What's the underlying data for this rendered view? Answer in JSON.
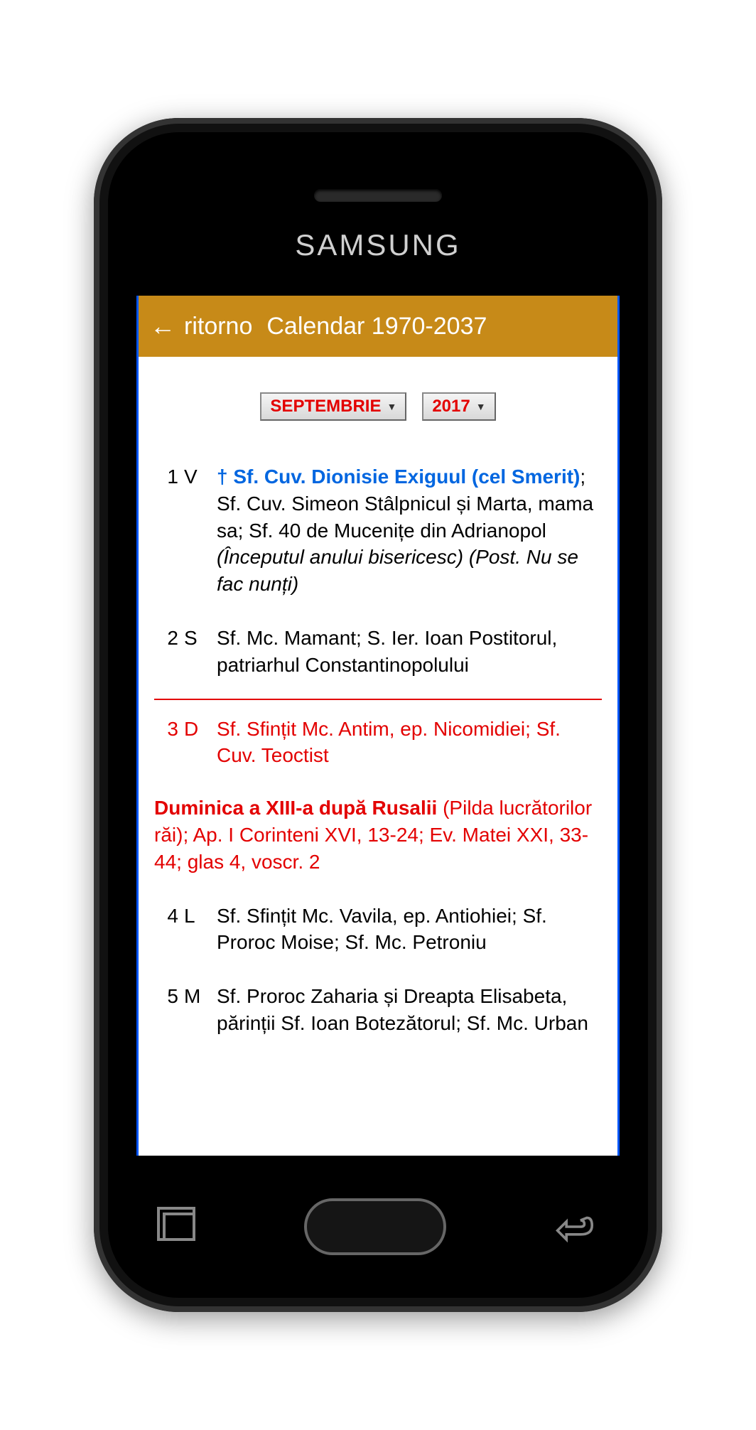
{
  "brand": "SAMSUNG",
  "appbar": {
    "back_label": "ritorno",
    "title": "Calendar 1970-2037"
  },
  "selectors": {
    "month": "SEPTEMBRIE",
    "year": "2017"
  },
  "days": [
    {
      "num": "1",
      "letter": "V",
      "cross": "†",
      "highlight": "Sf. Cuv. Dionisie Exiguul (cel Smerit)",
      "rest": "; Sf. Cuv. Simeon Stâlpnicul și Marta, mama sa; Sf. 40 de Mucenițe din Adrianopol",
      "italic": " (Începutul anului bisericesc) (Post. Nu se fac nunți)"
    },
    {
      "num": "2",
      "letter": "S",
      "text": "Sf. Mc. Mamant; S. Ier. Ioan Postitorul, patriarhul Constantinopolului"
    },
    {
      "num": "3",
      "letter": "D",
      "text": "Sf. Sfințit Mc. Antim, ep. Nicomidiei; Sf. Cuv. Teoctist",
      "red": true
    },
    {
      "num": "4",
      "letter": "L",
      "text": "Sf. Sfințit Mc. Vavila, ep. Antiohiei; Sf. Proroc Moise; Sf. Mc. Petroniu"
    },
    {
      "num": "5",
      "letter": "M",
      "text": "Sf. Proroc Zaharia și Dreapta Elisabeta, părinții Sf. Ioan Botezătorul; Sf. Mc. Urban"
    }
  ],
  "sunday_note": {
    "bold": "Duminica a XIII-a după Rusalii",
    "rest": " (Pilda lucrătorilor răi); Ap. I Corinteni XVI, 13-24; Ev. Matei XXI, 33-44; glas 4, voscr. 2"
  }
}
